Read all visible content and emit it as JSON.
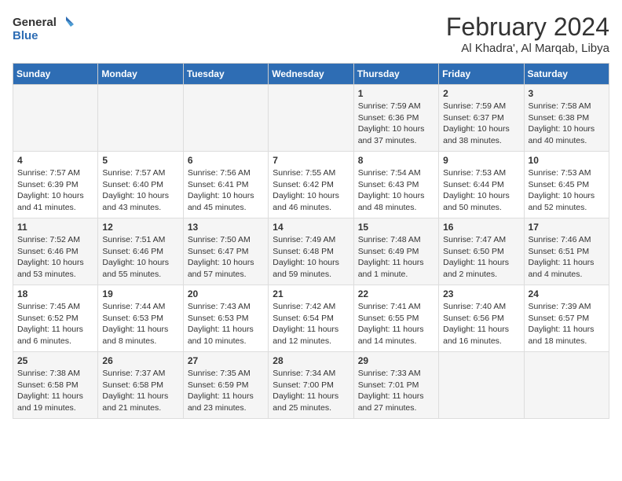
{
  "header": {
    "logo_line1": "General",
    "logo_line2": "Blue",
    "month_year": "February 2024",
    "location": "Al Khadra', Al Marqab, Libya"
  },
  "days_of_week": [
    "Sunday",
    "Monday",
    "Tuesday",
    "Wednesday",
    "Thursday",
    "Friday",
    "Saturday"
  ],
  "weeks": [
    [
      {
        "day": "",
        "info": ""
      },
      {
        "day": "",
        "info": ""
      },
      {
        "day": "",
        "info": ""
      },
      {
        "day": "",
        "info": ""
      },
      {
        "day": "1",
        "info": "Sunrise: 7:59 AM\nSunset: 6:36 PM\nDaylight: 10 hours\nand 37 minutes."
      },
      {
        "day": "2",
        "info": "Sunrise: 7:59 AM\nSunset: 6:37 PM\nDaylight: 10 hours\nand 38 minutes."
      },
      {
        "day": "3",
        "info": "Sunrise: 7:58 AM\nSunset: 6:38 PM\nDaylight: 10 hours\nand 40 minutes."
      }
    ],
    [
      {
        "day": "4",
        "info": "Sunrise: 7:57 AM\nSunset: 6:39 PM\nDaylight: 10 hours\nand 41 minutes."
      },
      {
        "day": "5",
        "info": "Sunrise: 7:57 AM\nSunset: 6:40 PM\nDaylight: 10 hours\nand 43 minutes."
      },
      {
        "day": "6",
        "info": "Sunrise: 7:56 AM\nSunset: 6:41 PM\nDaylight: 10 hours\nand 45 minutes."
      },
      {
        "day": "7",
        "info": "Sunrise: 7:55 AM\nSunset: 6:42 PM\nDaylight: 10 hours\nand 46 minutes."
      },
      {
        "day": "8",
        "info": "Sunrise: 7:54 AM\nSunset: 6:43 PM\nDaylight: 10 hours\nand 48 minutes."
      },
      {
        "day": "9",
        "info": "Sunrise: 7:53 AM\nSunset: 6:44 PM\nDaylight: 10 hours\nand 50 minutes."
      },
      {
        "day": "10",
        "info": "Sunrise: 7:53 AM\nSunset: 6:45 PM\nDaylight: 10 hours\nand 52 minutes."
      }
    ],
    [
      {
        "day": "11",
        "info": "Sunrise: 7:52 AM\nSunset: 6:46 PM\nDaylight: 10 hours\nand 53 minutes."
      },
      {
        "day": "12",
        "info": "Sunrise: 7:51 AM\nSunset: 6:46 PM\nDaylight: 10 hours\nand 55 minutes."
      },
      {
        "day": "13",
        "info": "Sunrise: 7:50 AM\nSunset: 6:47 PM\nDaylight: 10 hours\nand 57 minutes."
      },
      {
        "day": "14",
        "info": "Sunrise: 7:49 AM\nSunset: 6:48 PM\nDaylight: 10 hours\nand 59 minutes."
      },
      {
        "day": "15",
        "info": "Sunrise: 7:48 AM\nSunset: 6:49 PM\nDaylight: 11 hours\nand 1 minute."
      },
      {
        "day": "16",
        "info": "Sunrise: 7:47 AM\nSunset: 6:50 PM\nDaylight: 11 hours\nand 2 minutes."
      },
      {
        "day": "17",
        "info": "Sunrise: 7:46 AM\nSunset: 6:51 PM\nDaylight: 11 hours\nand 4 minutes."
      }
    ],
    [
      {
        "day": "18",
        "info": "Sunrise: 7:45 AM\nSunset: 6:52 PM\nDaylight: 11 hours\nand 6 minutes."
      },
      {
        "day": "19",
        "info": "Sunrise: 7:44 AM\nSunset: 6:53 PM\nDaylight: 11 hours\nand 8 minutes."
      },
      {
        "day": "20",
        "info": "Sunrise: 7:43 AM\nSunset: 6:53 PM\nDaylight: 11 hours\nand 10 minutes."
      },
      {
        "day": "21",
        "info": "Sunrise: 7:42 AM\nSunset: 6:54 PM\nDaylight: 11 hours\nand 12 minutes."
      },
      {
        "day": "22",
        "info": "Sunrise: 7:41 AM\nSunset: 6:55 PM\nDaylight: 11 hours\nand 14 minutes."
      },
      {
        "day": "23",
        "info": "Sunrise: 7:40 AM\nSunset: 6:56 PM\nDaylight: 11 hours\nand 16 minutes."
      },
      {
        "day": "24",
        "info": "Sunrise: 7:39 AM\nSunset: 6:57 PM\nDaylight: 11 hours\nand 18 minutes."
      }
    ],
    [
      {
        "day": "25",
        "info": "Sunrise: 7:38 AM\nSunset: 6:58 PM\nDaylight: 11 hours\nand 19 minutes."
      },
      {
        "day": "26",
        "info": "Sunrise: 7:37 AM\nSunset: 6:58 PM\nDaylight: 11 hours\nand 21 minutes."
      },
      {
        "day": "27",
        "info": "Sunrise: 7:35 AM\nSunset: 6:59 PM\nDaylight: 11 hours\nand 23 minutes."
      },
      {
        "day": "28",
        "info": "Sunrise: 7:34 AM\nSunset: 7:00 PM\nDaylight: 11 hours\nand 25 minutes."
      },
      {
        "day": "29",
        "info": "Sunrise: 7:33 AM\nSunset: 7:01 PM\nDaylight: 11 hours\nand 27 minutes."
      },
      {
        "day": "",
        "info": ""
      },
      {
        "day": "",
        "info": ""
      }
    ]
  ]
}
